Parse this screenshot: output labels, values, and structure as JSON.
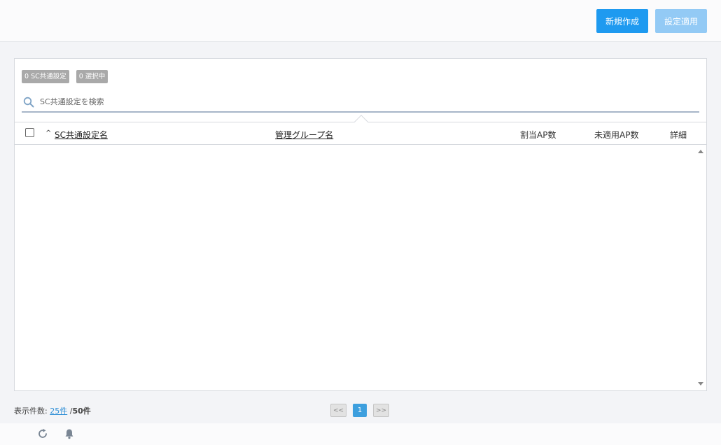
{
  "toolbar": {
    "new_label": "新規作成",
    "apply_label": "設定適用"
  },
  "panel": {
    "badges": [
      {
        "label": "0 SC共通設定"
      },
      {
        "label": "0 選択中"
      }
    ],
    "search": {
      "placeholder": "SC共通設定を検索",
      "value": ""
    },
    "table": {
      "sort_indicator": "^",
      "columns": [
        {
          "label": "SC共通設定名",
          "sortable": true
        },
        {
          "label": "管理グループ名",
          "sortable": true
        },
        {
          "label": "割当AP数",
          "sortable": false
        },
        {
          "label": "未適用AP数",
          "sortable": false
        },
        {
          "label": "詳細",
          "sortable": false
        }
      ],
      "rows": []
    }
  },
  "footer": {
    "count_label": "表示件数:",
    "per_page": "25件",
    "separator": "/",
    "total": "50件",
    "pagination": {
      "prev": "<<",
      "current": "1",
      "next": ">>"
    }
  },
  "icons": {
    "refresh": "refresh-icon",
    "notification": "bell-icon",
    "search": "search-icon"
  },
  "colors": {
    "primary": "#1e9af0",
    "primary_disabled": "#93caf5",
    "badge": "#a9a9a9",
    "page_current": "#3d9fde",
    "link": "#2f8fd6"
  }
}
